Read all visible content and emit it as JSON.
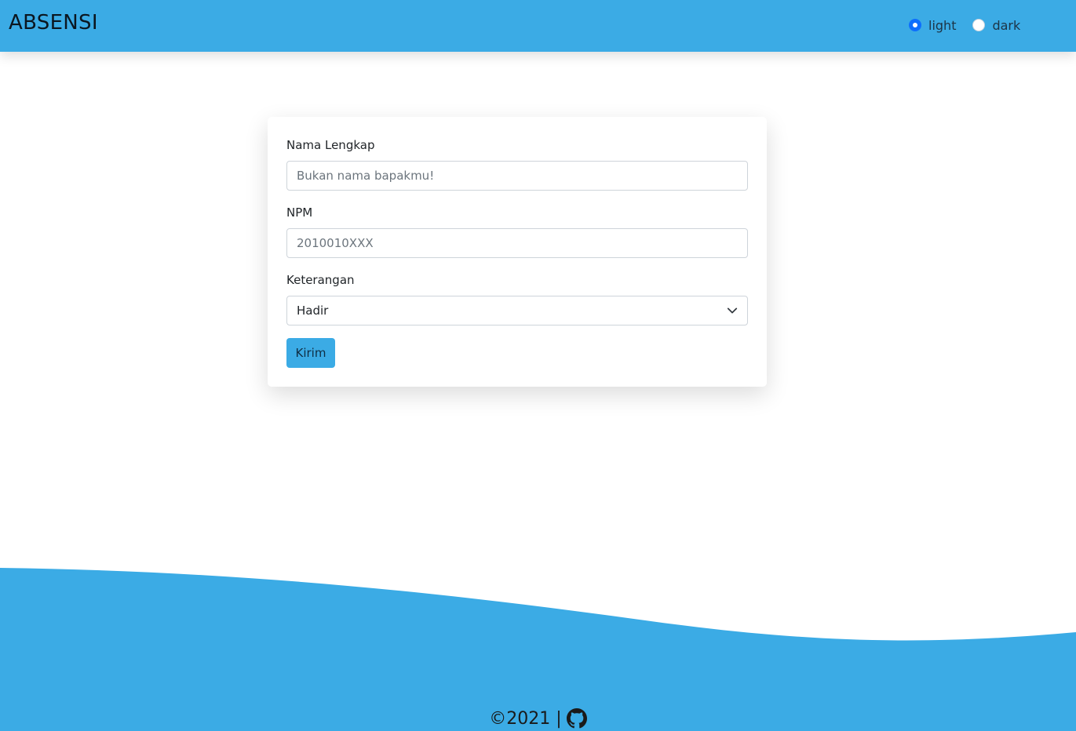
{
  "header": {
    "brand": "ABSENSI",
    "theme_options": [
      {
        "label": "light",
        "checked": true
      },
      {
        "label": "dark",
        "checked": false
      }
    ]
  },
  "form": {
    "name_label": "Nama Lengkap",
    "name_placeholder": "Bukan nama bapakmu!",
    "npm_label": "NPM",
    "npm_placeholder": "2010010XXX",
    "keterangan_label": "Keterangan",
    "keterangan_value": "Hadir",
    "submit_label": "Kirim"
  },
  "footer": {
    "copyright": "©2021 |",
    "icon": "github-icon"
  },
  "colors": {
    "primary": "#3babe5",
    "radio_accent": "#0d6efd"
  }
}
